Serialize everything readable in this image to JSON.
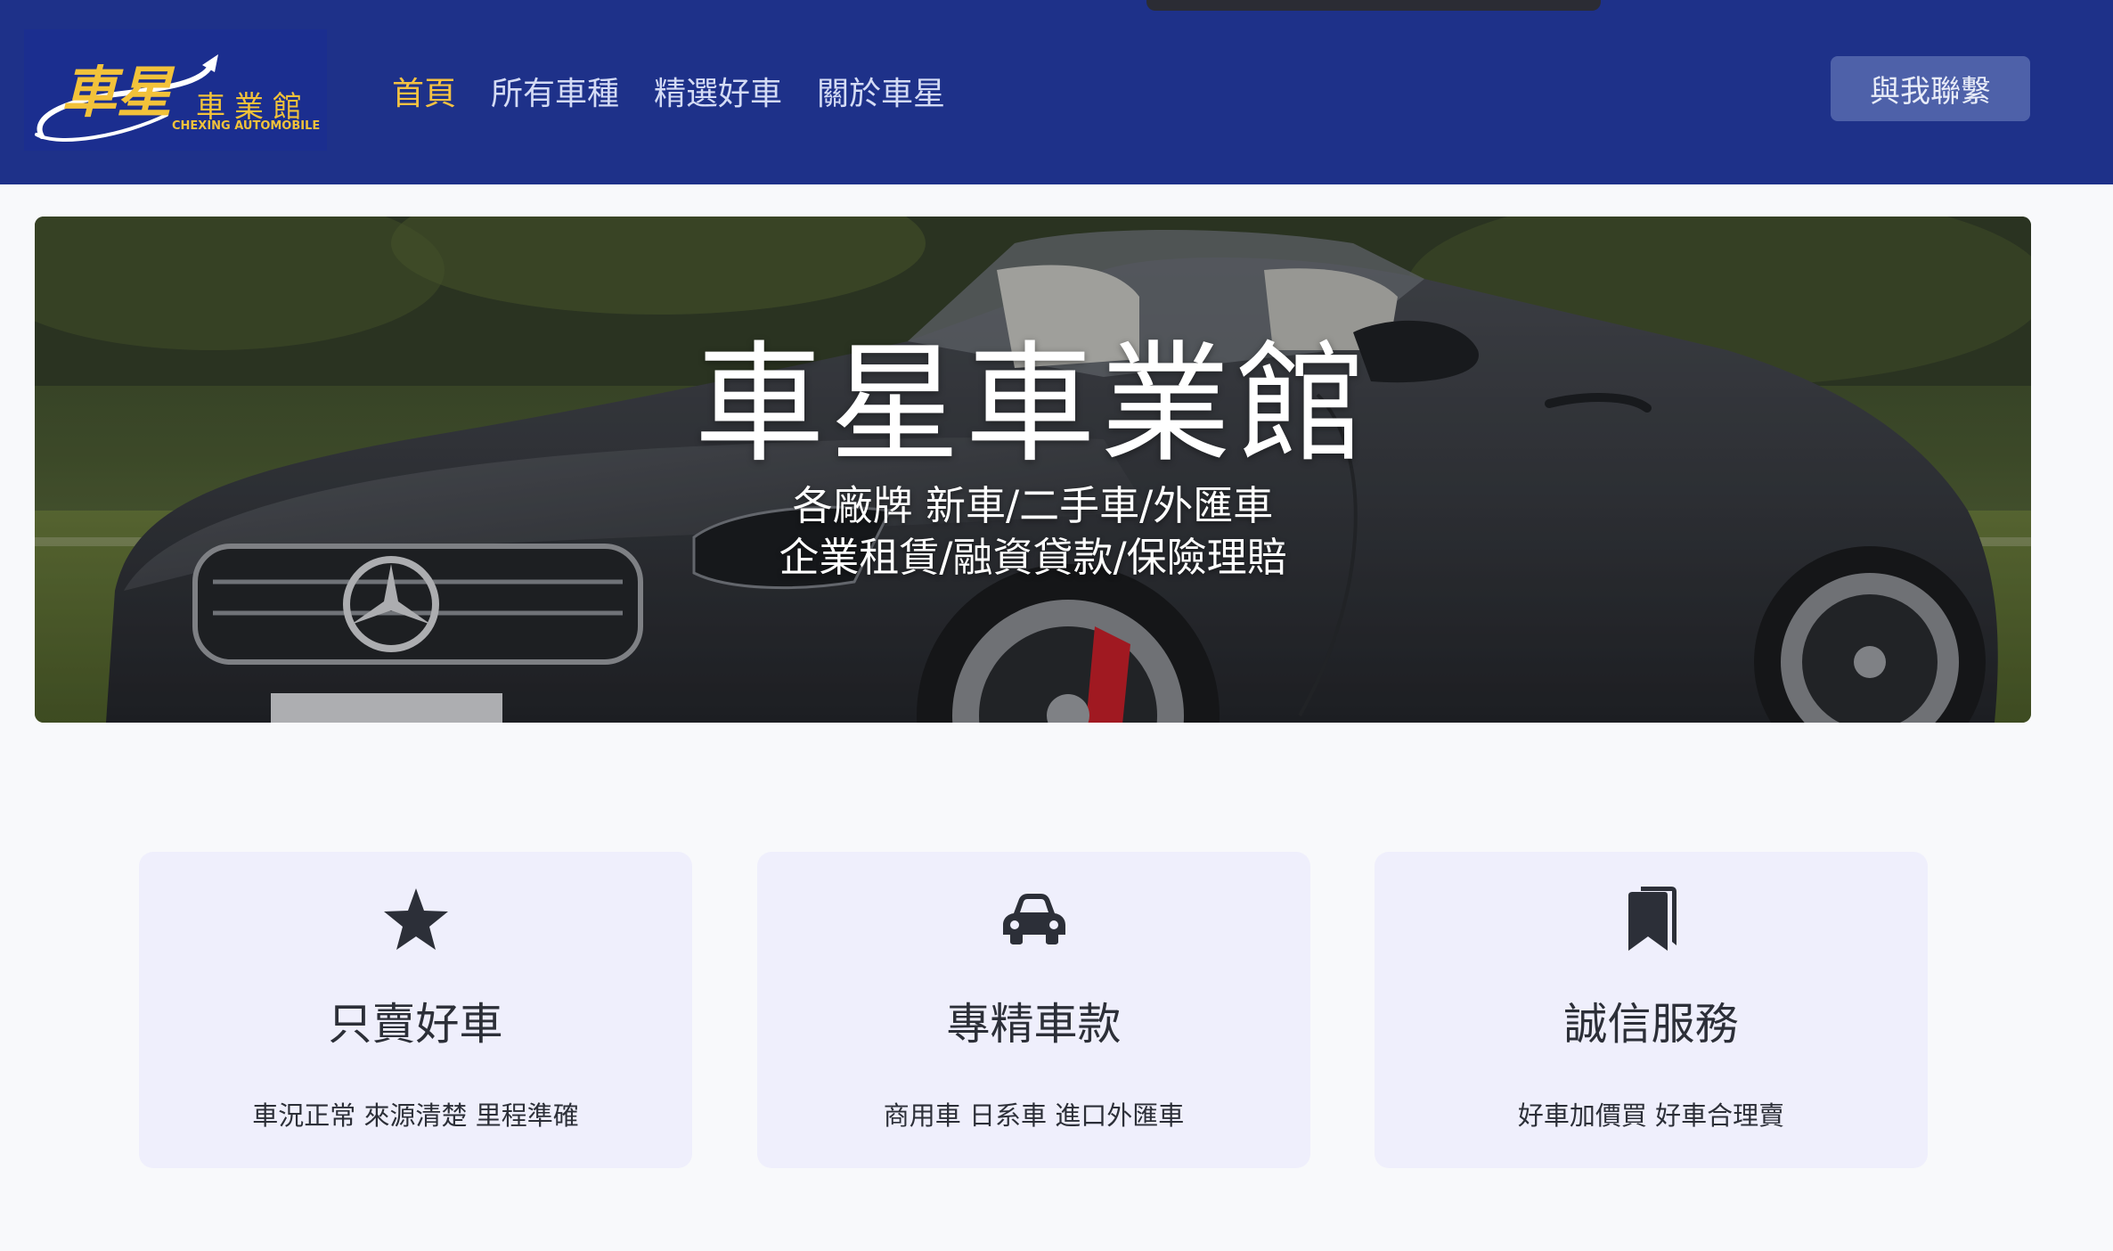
{
  "brand": {
    "logo_glyph": "車星",
    "logo_text": "車業館",
    "logo_sub": "CHEXING AUTOMOBILE",
    "colors": {
      "navbar": "#1e3189",
      "accent": "#f5c242",
      "logo_gold": "#f2c23a"
    }
  },
  "nav": {
    "items": [
      {
        "label": "首頁",
        "active": true
      },
      {
        "label": "所有車種",
        "active": false
      },
      {
        "label": "精選好車",
        "active": false
      },
      {
        "label": "關於車星",
        "active": false
      }
    ],
    "contact_label": "與我聯繫"
  },
  "hero": {
    "title": "車星車業館",
    "subtitle_line1": "各廠牌 新車/二手車/外匯車",
    "subtitle_line2": "企業租賃/融資貸款/保險理賠",
    "image": "convertible-car-photo"
  },
  "features": [
    {
      "icon": "star-icon",
      "title": "只賣好車",
      "text": "車況正常 來源清楚 里程準確"
    },
    {
      "icon": "car-icon",
      "title": "專精車款",
      "text": "商用車 日系車 進口外匯車"
    },
    {
      "icon": "bookmarks-icon",
      "title": "誠信服務",
      "text": "好車加價買 好車合理賣"
    }
  ]
}
